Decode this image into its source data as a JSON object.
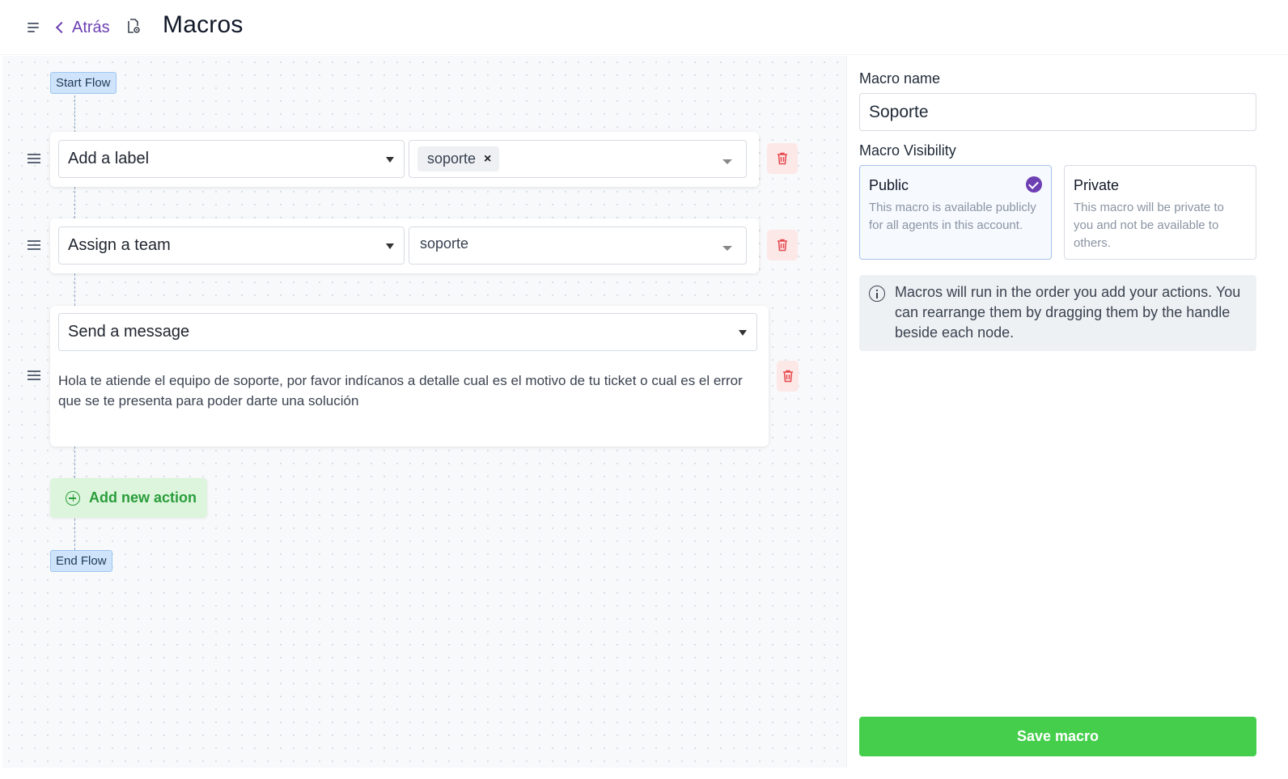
{
  "header": {
    "back_label": "Atrás",
    "title": "Macros",
    "icons": [
      "menu-icon",
      "chevron-left-icon",
      "macro-settings-icon"
    ]
  },
  "flow": {
    "start_label": "Start Flow",
    "end_label": "End Flow",
    "actions": [
      {
        "type": "Add a label",
        "value": "soporte",
        "value_style": "tag"
      },
      {
        "type": "Assign a team",
        "value": "soporte",
        "value_style": "select"
      },
      {
        "type": "Send a message",
        "message": "Hola te atiende el equipo de soporte, por favor indícanos a detalle cual es el motivo de tu ticket o cual es el error que se te presenta para poder darte una solución"
      }
    ],
    "add_action_label": "Add new action"
  },
  "panel": {
    "name_label": "Macro name",
    "name_value": "Soporte",
    "visibility_label": "Macro Visibility",
    "visibility_options": [
      {
        "title": "Public",
        "description": "This macro is available publicly for all agents in this account.",
        "selected": true
      },
      {
        "title": "Private",
        "description": "This macro will be private to you and not be available to others.",
        "selected": false
      }
    ],
    "info_text": "Macros will run in the order you add your actions. You can rearrange them by dragging them by the handle beside each node.",
    "save_label": "Save macro"
  },
  "colors": {
    "accent": "#6c3fb3",
    "save": "#44ce4b",
    "danger_bg": "#fde8e8",
    "danger_icon": "#e5484d"
  }
}
